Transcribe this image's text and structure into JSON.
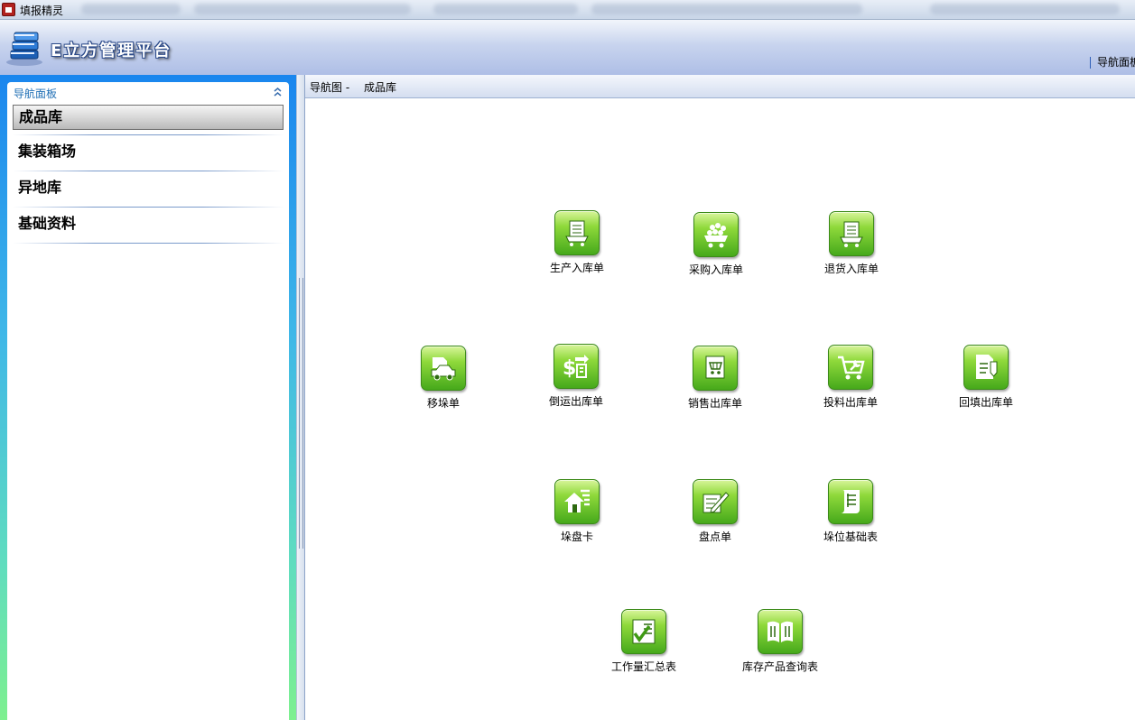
{
  "window": {
    "title": "填报精灵"
  },
  "header": {
    "brand": "E立方管理平台",
    "nav_panel_link": "导航面板"
  },
  "nav_panel": {
    "title": "导航面板",
    "items": [
      {
        "label": "成品库",
        "selected": true
      },
      {
        "label": "集装箱场"
      },
      {
        "label": "异地库"
      },
      {
        "label": "基础资料"
      }
    ]
  },
  "breadcrumb": {
    "prefix": "导航图 -",
    "current": "成品库"
  },
  "tiles": [
    {
      "label": "生产入库单",
      "icon": "cart-receipt-icon"
    },
    {
      "label": "采购入库单",
      "icon": "cart-full-icon"
    },
    {
      "label": "退货入库单",
      "icon": "cart-return-icon"
    },
    {
      "label": "移垛单",
      "icon": "truck-icon"
    },
    {
      "label": "倒运出库单",
      "icon": "money-transfer-icon"
    },
    {
      "label": "销售出库单",
      "icon": "sales-cart-icon"
    },
    {
      "label": "投料出库单",
      "icon": "cart-wrench-icon"
    },
    {
      "label": "回填出库单",
      "icon": "document-edit-icon"
    },
    {
      "label": "垛盘卡",
      "icon": "warehouse-card-icon"
    },
    {
      "label": "盘点单",
      "icon": "pencil-sheet-icon"
    },
    {
      "label": "垛位基础表",
      "icon": "scroll-list-icon"
    },
    {
      "label": "工作量汇总表",
      "icon": "checklist-icon"
    },
    {
      "label": "库存产品查询表",
      "icon": "open-book-icon"
    }
  ],
  "colors": {
    "tile_green": "#5cbf22",
    "nav_gradient_top": "#1a86ee",
    "nav_gradient_bottom": "#7ef08f",
    "header_blue": "#aebee6"
  }
}
